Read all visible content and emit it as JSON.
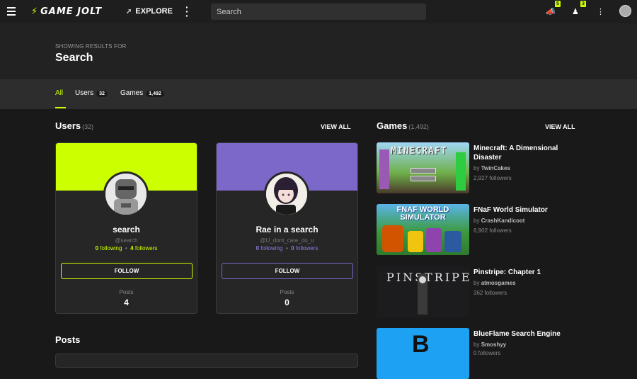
{
  "topbar": {
    "explore_label": "EXPLORE",
    "search_placeholder": "Search",
    "notifications_badge": "5",
    "friends_badge": "3"
  },
  "header": {
    "showing_label": "SHOWING RESULTS FOR",
    "query": "Search"
  },
  "tabs": [
    {
      "label": "All",
      "count": ""
    },
    {
      "label": "Users",
      "count": "32"
    },
    {
      "label": "Games",
      "count": "1,492"
    }
  ],
  "users_section": {
    "title": "Users",
    "count": "(32)",
    "view_all": "VIEW ALL",
    "cards": [
      {
        "name": "search",
        "handle": "@search",
        "following": "0",
        "following_label": "following",
        "followers": "4",
        "followers_label": "followers",
        "follow_label": "FOLLOW",
        "posts_label": "Posts",
        "posts": "4",
        "accent": "#ccff00"
      },
      {
        "name": "Rae in a search",
        "handle": "@U_dont_care_do_u",
        "following": "0",
        "following_label": "following",
        "followers": "0",
        "followers_label": "followers",
        "follow_label": "FOLLOW",
        "posts_label": "Posts",
        "posts": "0",
        "accent": "#7b68c9"
      }
    ]
  },
  "games_section": {
    "title": "Games",
    "count": "(1,492)",
    "view_all": "VIEW ALL",
    "items": [
      {
        "title": "Minecraft: A Dimensional Disaster",
        "by": "by",
        "author": "TwinCakes",
        "followers": "2,927 followers",
        "thumb_text": "MINECRAFT"
      },
      {
        "title": "FNaF World Simulator",
        "by": "by",
        "author": "CrashKandicoot",
        "followers": "6,902 followers",
        "thumb_text": "FNAF WORLD SIMULATOR"
      },
      {
        "title": "Pinstripe: Chapter 1",
        "by": "by",
        "author": "atmosgames",
        "followers": "362 followers",
        "thumb_text": "PINSTRIPE"
      },
      {
        "title": "BlueFlame Search Engine",
        "by": "by",
        "author": "Smoshyy",
        "followers": "0 followers",
        "thumb_text": "B"
      }
    ]
  },
  "posts_section": {
    "title": "Posts"
  },
  "colors": {
    "accent": "#ccff00",
    "purple": "#7b68c9",
    "background": "#191919"
  }
}
